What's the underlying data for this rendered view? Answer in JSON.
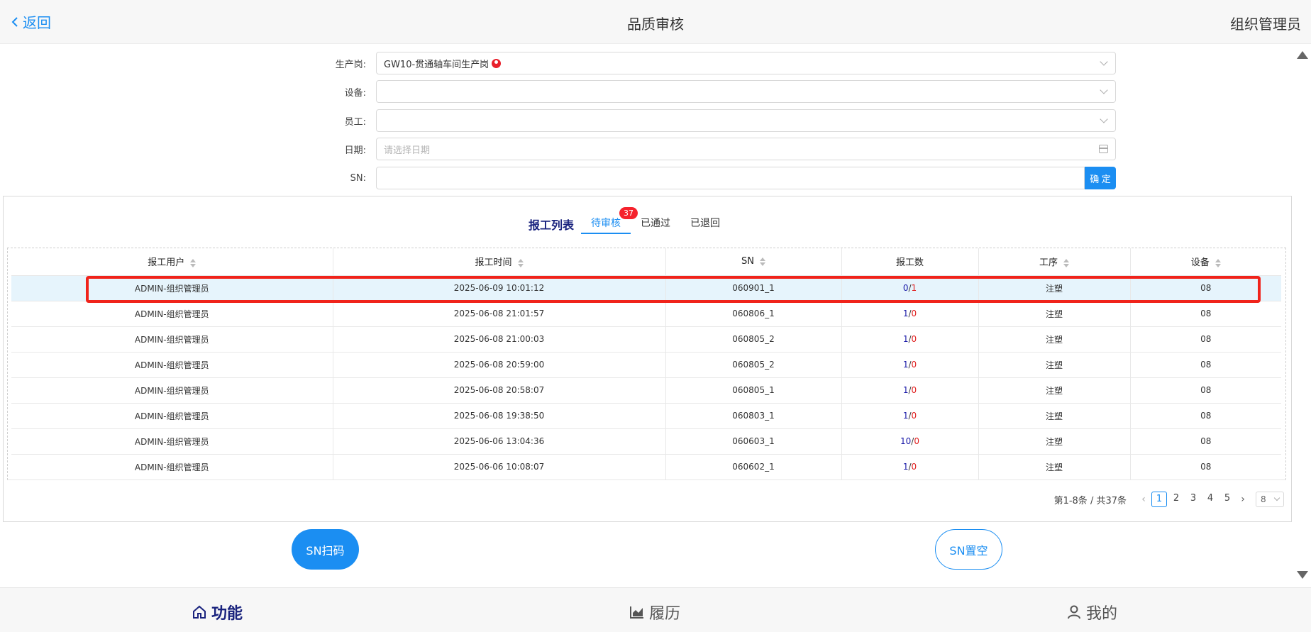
{
  "header": {
    "back_label": "返回",
    "title": "品质审核",
    "user_role": "组织管理员"
  },
  "form": {
    "post_label": "生产岗:",
    "post_value": "GW10-贯通轴车间生产岗",
    "device_label": "设备:",
    "device_value": "",
    "employee_label": "员工:",
    "employee_value": "",
    "date_label": "日期:",
    "date_placeholder": "请选择日期",
    "sn_label": "SN:",
    "sn_value": "",
    "confirm_label": "确 定"
  },
  "report_list": {
    "title": "报工列表",
    "tabs": [
      {
        "label": "待审核",
        "badge": "37",
        "active": true
      },
      {
        "label": "已通过"
      },
      {
        "label": "已退回"
      }
    ],
    "columns": [
      "报工用户",
      "报工时间",
      "SN",
      "报工数",
      "工序",
      "设备"
    ],
    "rows": [
      {
        "user": "ADMIN-组织管理员",
        "time": "2025-06-09 10:01:12",
        "sn": "060901_1",
        "ok": "0",
        "ng": "1",
        "process": "注塑",
        "device": "08",
        "selected": true
      },
      {
        "user": "ADMIN-组织管理员",
        "time": "2025-06-08 21:01:57",
        "sn": "060806_1",
        "ok": "1",
        "ng": "0",
        "process": "注塑",
        "device": "08"
      },
      {
        "user": "ADMIN-组织管理员",
        "time": "2025-06-08 21:00:03",
        "sn": "060805_2",
        "ok": "1",
        "ng": "0",
        "process": "注塑",
        "device": "08"
      },
      {
        "user": "ADMIN-组织管理员",
        "time": "2025-06-08 20:59:00",
        "sn": "060805_2",
        "ok": "1",
        "ng": "0",
        "process": "注塑",
        "device": "08"
      },
      {
        "user": "ADMIN-组织管理员",
        "time": "2025-06-08 20:58:07",
        "sn": "060805_1",
        "ok": "1",
        "ng": "0",
        "process": "注塑",
        "device": "08"
      },
      {
        "user": "ADMIN-组织管理员",
        "time": "2025-06-08 19:38:50",
        "sn": "060803_1",
        "ok": "1",
        "ng": "0",
        "process": "注塑",
        "device": "08"
      },
      {
        "user": "ADMIN-组织管理员",
        "time": "2025-06-06 13:04:36",
        "sn": "060603_1",
        "ok": "10",
        "ng": "0",
        "process": "注塑",
        "device": "08"
      },
      {
        "user": "ADMIN-组织管理员",
        "time": "2025-06-06 10:08:07",
        "sn": "060602_1",
        "ok": "1",
        "ng": "0",
        "process": "注塑",
        "device": "08"
      }
    ]
  },
  "pagination": {
    "total_text": "第1-8条 / 共37条",
    "pages": [
      "1",
      "2",
      "3",
      "4",
      "5"
    ],
    "current": "1",
    "page_size": "8"
  },
  "actions": {
    "scan_label": "SN扫码",
    "clear_label": "SN置空"
  },
  "bottom_nav": {
    "items": [
      {
        "label": "功能",
        "icon": "home-icon",
        "active": true
      },
      {
        "label": "履历",
        "icon": "chart-icon"
      },
      {
        "label": "我的",
        "icon": "user-icon"
      }
    ]
  },
  "colors": {
    "accent": "#1b8ef2",
    "highlight_border": "#f0231b",
    "badge": "#f5222d",
    "ok_number": "#1a1aa8",
    "ng_number": "#e02020",
    "nav_active": "#1a237e"
  }
}
